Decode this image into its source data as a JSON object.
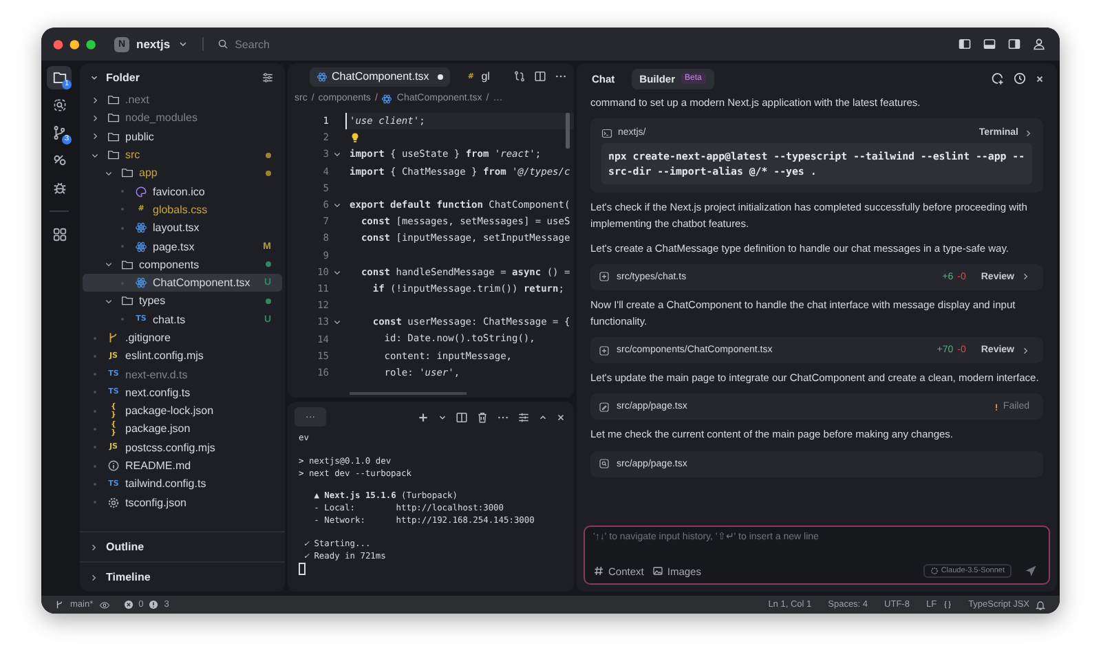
{
  "title_bar": {
    "project_initial": "N",
    "project_name": "nextjs",
    "search": {
      "placeholder": "Search"
    }
  },
  "activity_bar": {
    "groups": [
      [
        {
          "kind": "files",
          "selected": true,
          "badge": "1"
        },
        {
          "kind": "search",
          "selected": false
        },
        {
          "kind": "git",
          "selected": false,
          "badge": "3"
        },
        {
          "kind": "remote",
          "selected": false
        },
        {
          "kind": "debug",
          "selected": false
        }
      ],
      [
        {
          "kind": "extensions",
          "selected": false
        }
      ]
    ]
  },
  "sidebar": {
    "title": "Folder",
    "tree": [
      {
        "name": ".next",
        "kind": "folder",
        "expanded": false,
        "dimmed": true,
        "changed": false,
        "selected": false
      },
      {
        "name": "node_modules",
        "kind": "folder",
        "expanded": false,
        "dimmed": true,
        "changed": false,
        "selected": false
      },
      {
        "name": "public",
        "kind": "folder",
        "expanded": false,
        "dimmed": false,
        "changed": false,
        "selected": false
      },
      {
        "name": "src",
        "kind": "folder",
        "expanded": true,
        "dimmed": false,
        "changed": true,
        "selected": false,
        "color": "#9a8430",
        "children": [
          {
            "name": "app",
            "kind": "folder",
            "expanded": true,
            "dimmed": false,
            "changed": true,
            "selected": false,
            "color": "#9a8430",
            "children": [
              {
                "name": "favicon.ico",
                "kind": "favicon",
                "dimmed": false,
                "changed": false,
                "selected": false
              },
              {
                "name": "globals.css",
                "kind": "css",
                "glyph": "#",
                "dimmed": false,
                "changed": true,
                "selected": false
              },
              {
                "name": "layout.tsx",
                "kind": "react",
                "dimmed": false,
                "changed": false,
                "selected": false
              },
              {
                "name": "page.tsx",
                "kind": "react",
                "dimmed": false,
                "changed": false,
                "selected": false,
                "badge": "M",
                "color": "#b59a3a"
              }
            ]
          },
          {
            "name": "components",
            "kind": "folder",
            "expanded": true,
            "dimmed": false,
            "changed": false,
            "selected": false,
            "color": "#2e8a5e",
            "children": [
              {
                "name": "ChatComponent.tsx",
                "kind": "react",
                "dimmed": false,
                "changed": false,
                "selected": true,
                "badge": "U",
                "color": "#2e8a5e"
              }
            ]
          },
          {
            "name": "types",
            "kind": "folder",
            "expanded": true,
            "dimmed": false,
            "changed": false,
            "selected": false,
            "color": "#2e8a5e",
            "children": [
              {
                "name": "chat.ts",
                "kind": "ts",
                "glyph": "TS",
                "dimmed": false,
                "changed": false,
                "selected": false,
                "badge": "U",
                "color": "#2e8a5e"
              }
            ]
          }
        ]
      },
      {
        "name": ".gitignore",
        "kind": "git",
        "dimmed": false,
        "changed": false,
        "selected": false
      },
      {
        "name": "eslint.config.mjs",
        "kind": "js",
        "glyph": "JS",
        "dimmed": false,
        "changed": false,
        "selected": false
      },
      {
        "name": "next-env.d.ts",
        "kind": "ts",
        "glyph": "TS",
        "dimmed": true,
        "changed": false,
        "selected": false
      },
      {
        "name": "next.config.ts",
        "kind": "ts",
        "glyph": "TS",
        "dimmed": false,
        "changed": false,
        "selected": false
      },
      {
        "name": "package-lock.json",
        "kind": "json",
        "glyph": "{ }",
        "dimmed": false,
        "changed": false,
        "selected": false
      },
      {
        "name": "package.json",
        "kind": "json",
        "glyph": "{ }",
        "dimmed": false,
        "changed": false,
        "selected": false
      },
      {
        "name": "postcss.config.mjs",
        "kind": "js",
        "glyph": "JS",
        "dimmed": false,
        "changed": false,
        "selected": false
      },
      {
        "name": "README.md",
        "kind": "info",
        "dimmed": false,
        "changed": false,
        "selected": false
      },
      {
        "name": "tailwind.config.ts",
        "kind": "ts",
        "glyph": "TS",
        "dimmed": false,
        "changed": false,
        "selected": false
      },
      {
        "name": "tsconfig.json",
        "kind": "gear",
        "dimmed": false,
        "changed": false,
        "selected": false
      }
    ],
    "sections": [
      {
        "label": "Outline",
        "expanded": false
      },
      {
        "label": "Timeline",
        "expanded": false
      }
    ]
  },
  "editor": {
    "tabs": [
      {
        "label": "ChatComponent.tsx",
        "kind": "react",
        "selected": true,
        "modified": true
      },
      {
        "label": "gl",
        "kind": "css",
        "glyph": "#",
        "selected": false,
        "modified": false
      }
    ],
    "breadcrumb": [
      {
        "label": "src",
        "kind": "item"
      },
      {
        "label": "/",
        "kind": "sep"
      },
      {
        "label": "components",
        "kind": "item"
      },
      {
        "label": "/",
        "kind": "sep"
      },
      {
        "label": "ChatComponent.tsx",
        "kind": "react"
      },
      {
        "label": "/",
        "kind": "sep"
      },
      {
        "label": "…",
        "kind": "item"
      }
    ],
    "lines": [
      {
        "n": "1",
        "fold": false,
        "bulb": false,
        "cursor": true,
        "text": "*'use client'*;"
      },
      {
        "n": "2",
        "fold": false,
        "bulb": true,
        "cursor": false
      },
      {
        "n": "3",
        "fold": true,
        "bulb": false,
        "cursor": false,
        "text": "**import** { useState } **from** *'react'*;"
      },
      {
        "n": "4",
        "fold": false,
        "bulb": false,
        "cursor": false,
        "text": "**import** { ChatMessage } **from** *'@/types/c*"
      },
      {
        "n": "5",
        "fold": false,
        "bulb": false,
        "cursor": false
      },
      {
        "n": "6",
        "fold": true,
        "bulb": false,
        "cursor": false,
        "text": "**export default function** ChatComponent("
      },
      {
        "n": "7",
        "fold": false,
        "bulb": false,
        "cursor": false,
        "text": "  **const** [messages, setMessages] = useS"
      },
      {
        "n": "8",
        "fold": false,
        "bulb": false,
        "cursor": false,
        "text": "  **const** [inputMessage, setInputMessage"
      },
      {
        "n": "9",
        "fold": false,
        "bulb": false,
        "cursor": false
      },
      {
        "n": "10",
        "fold": true,
        "bulb": false,
        "cursor": false,
        "text": "  **const** handleSendMessage = **async** () ="
      },
      {
        "n": "11",
        "fold": false,
        "bulb": false,
        "cursor": false,
        "text": "    **if** (!inputMessage.trim()) **return**;"
      },
      {
        "n": "12",
        "fold": false,
        "bulb": false,
        "cursor": false
      },
      {
        "n": "13",
        "fold": true,
        "bulb": false,
        "cursor": false,
        "text": "    **const** userMessage: ChatMessage = {"
      },
      {
        "n": "14",
        "fold": false,
        "bulb": false,
        "cursor": false,
        "text": "      id: Date.now().toString(),"
      },
      {
        "n": "15",
        "fold": false,
        "bulb": false,
        "cursor": false,
        "text": "      content: inputMessage,"
      },
      {
        "n": "16",
        "fold": false,
        "bulb": false,
        "cursor": false,
        "text": "      role: *'user'*,"
      }
    ]
  },
  "terminal": {
    "tab": "···",
    "blocks": [
      [
        "ev"
      ],
      [
        "> nextjs@0.1.0 dev",
        "> next dev --turbopack"
      ],
      [
        "   **▲ Next.js 15.1.6** (Turbopack)",
        "   - Local:        http://localhost:3000",
        "   - Network:      http://192.168.254.145:3000"
      ],
      [
        " *✓* Starting...",
        " *✓* Ready in 721ms"
      ]
    ]
  },
  "chat": {
    "tabs": [
      {
        "label": "Chat",
        "selected": false
      },
      {
        "label": "Builder",
        "selected": true,
        "badge": "Beta"
      }
    ],
    "messages": [
      {
        "kind": "text",
        "text": "command to set up a modern Next.js application with the latest features."
      },
      {
        "kind": "command",
        "folder": "nextjs/",
        "action": "Terminal",
        "code": "npx create-next-app@latest --typescript --tailwind --eslint --app -- src-dir --import-alias @/* --yes ."
      },
      {
        "kind": "text",
        "text": "Let's check if the Next.js project initialization has completed successfully before proceeding with implementing the chatbot features."
      },
      {
        "kind": "text",
        "text": "Let's create a ChatMessage type definition to handle our chat messages in a type-safe way."
      },
      {
        "kind": "file",
        "path": "src/types/chat.ts",
        "added": "+6",
        "removed": "-0",
        "action": "Review"
      },
      {
        "kind": "text",
        "text": "Now I'll create a ChatComponent to handle the chat interface with message display and input functionality."
      },
      {
        "kind": "file",
        "path": "src/components/ChatComponent.tsx",
        "added": "+70",
        "removed": "-0",
        "action": "Review"
      },
      {
        "kind": "text",
        "text": "Let's update the main page to integrate our ChatComponent and create a clean, modern interface."
      },
      {
        "kind": "failed",
        "path": "src/app/page.tsx",
        "status": "Failed"
      },
      {
        "kind": "text",
        "text": "Let me check the current content of the main page before making any changes."
      },
      {
        "kind": "read",
        "path": "src/app/page.tsx"
      }
    ],
    "composer": {
      "placeholder": "'↑↓' to navigate input history, '⇧↵' to insert a new line",
      "context": "Context",
      "images": "Images",
      "model": "Claude-3.5-Sonnet"
    }
  },
  "status_bar": {
    "branch": "main*",
    "errors": "0",
    "warnings": "3",
    "items": [
      "Ln 1, Col 1",
      "Spaces: 4",
      "UTF-8",
      "LF"
    ],
    "language": "TypeScript JSX"
  }
}
